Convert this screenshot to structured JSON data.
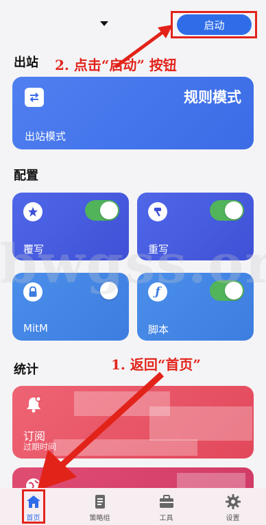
{
  "header": {
    "start_button": "启动"
  },
  "annotations": {
    "step2": "2. 点击“启动” 按钮",
    "step1": "1. 返回“首页”"
  },
  "sections": {
    "outbound": "出站",
    "config": "配置",
    "stats": "统计"
  },
  "outbound_card": {
    "mode_value": "规则模式",
    "label": "出站模式",
    "icon": "swap-arrows-icon"
  },
  "config_tiles": [
    {
      "label": "覆写",
      "icon": "star-icon",
      "toggle": true
    },
    {
      "label": "重写",
      "icon": "hammer-icon",
      "toggle": true
    },
    {
      "label": "MitM",
      "icon": "lock-icon",
      "toggle": false
    },
    {
      "label": "脚本",
      "icon": "function-icon",
      "toggle": true
    }
  ],
  "stats_cards": [
    {
      "label": "订阅",
      "sublabel": "过期时间",
      "icon": "bell-icon"
    },
    {
      "label": "",
      "sublabel": "",
      "icon": "globe-icon"
    }
  ],
  "watermark": "bwgss.org",
  "tabbar": {
    "items": [
      {
        "label": "首页",
        "icon": "home-icon",
        "active": true
      },
      {
        "label": "策略组",
        "icon": "document-icon",
        "active": false
      },
      {
        "label": "工具",
        "icon": "toolbox-icon",
        "active": false
      },
      {
        "label": "设置",
        "icon": "gear-icon",
        "active": false
      }
    ]
  },
  "colors": {
    "accent": "#2f6de8",
    "annotation_red": "#e2231a",
    "toggle_on": "#51b35a",
    "stats_red": "#e2485b"
  }
}
